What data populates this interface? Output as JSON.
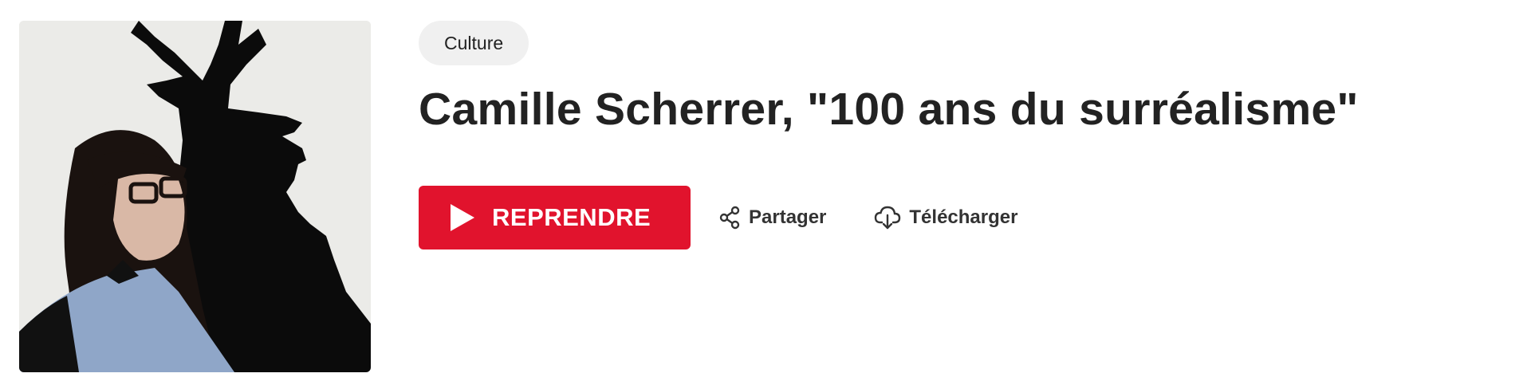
{
  "episode": {
    "category": "Culture",
    "title": "Camille Scherrer, \"100 ans du surréalisme\"",
    "cover_alt": "Camille Scherrer avec une silhouette de cerf en ombre"
  },
  "actions": {
    "resume_label": "REPRENDRE",
    "share_label": "Partager",
    "download_label": "Télécharger"
  },
  "colors": {
    "accent": "#e1132d",
    "tag_bg": "#f0f0f0",
    "text": "#222222"
  },
  "icons": {
    "resume": "play-icon",
    "share": "share-icon",
    "download": "cloud-download-icon"
  }
}
